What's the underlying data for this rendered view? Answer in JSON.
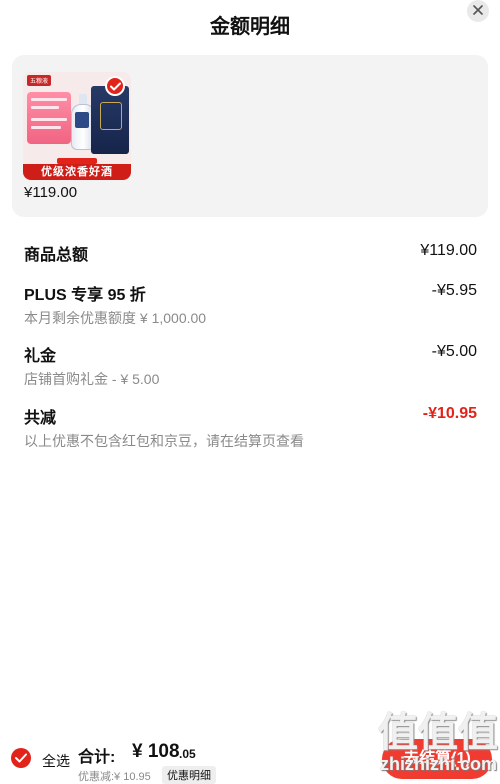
{
  "header": {
    "title": "金额明细",
    "close_icon": "close-icon"
  },
  "product": {
    "thumbnail_banner": "优级浓香好酒",
    "thumbnail_brand": "五粮液",
    "price": "¥119.00",
    "selected": true
  },
  "breakdown": {
    "goods_total": {
      "label": "商品总额",
      "value": "¥119.00"
    },
    "plus_discount": {
      "label": "PLUS 专享 95 折",
      "value": "-¥5.95",
      "note": "本月剩余优惠额度 ¥ 1,000.00"
    },
    "gift_money": {
      "label": "礼金",
      "value": "-¥5.00",
      "note": "店铺首购礼金 - ¥ 5.00"
    },
    "total_reduction": {
      "label": "共减",
      "value": "-¥10.95",
      "note": "以上优惠不包含红包和京豆，请在结算页查看"
    }
  },
  "footer": {
    "select_all_label": "全选",
    "total_label": "合计:",
    "total_main": "¥ 108",
    "total_decimal": ".05",
    "discount_text": "优惠减:¥ 10.95",
    "detail_button": "优惠明细",
    "checkout_button": "去结算(1)"
  },
  "watermark": {
    "glyphs": "值值值",
    "text": "zhizhizhi.com"
  },
  "colors": {
    "accent": "#e2231a",
    "card_bg": "#f3f3f3",
    "muted_text": "#8a8a8a"
  }
}
